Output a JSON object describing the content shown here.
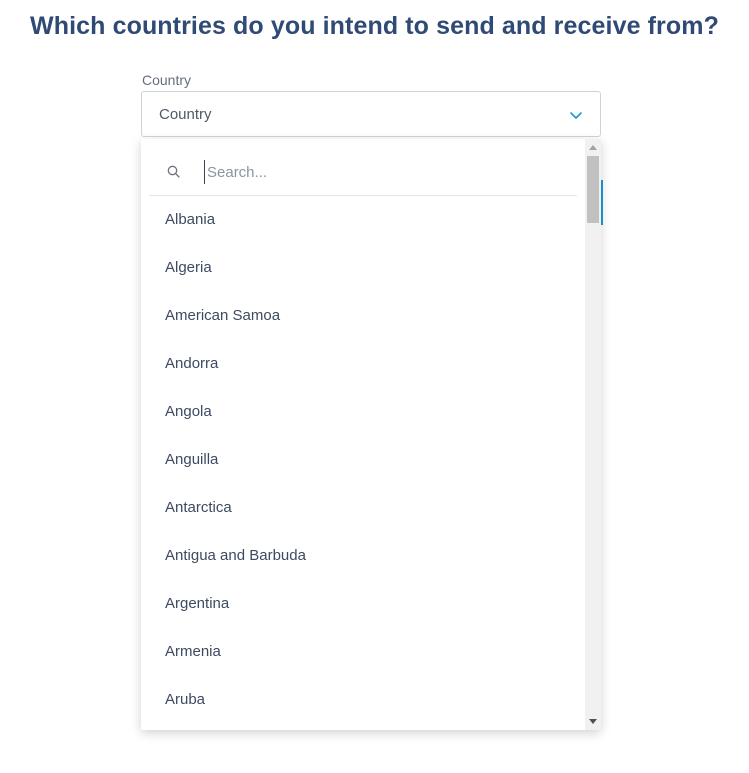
{
  "page": {
    "heading": "Which countries do you intend to send and receive from?"
  },
  "country_select": {
    "label": "Country",
    "value": "Country",
    "chevron_icon": "chevron-down-icon",
    "accent_color": "#1a9bd7"
  },
  "dropdown": {
    "search": {
      "icon": "search-icon",
      "placeholder": "Search...",
      "value": ""
    },
    "options": [
      {
        "label": "Albania"
      },
      {
        "label": "Algeria"
      },
      {
        "label": "American Samoa"
      },
      {
        "label": "Andorra"
      },
      {
        "label": "Angola"
      },
      {
        "label": "Anguilla"
      },
      {
        "label": "Antarctica"
      },
      {
        "label": "Antigua and Barbuda"
      },
      {
        "label": "Argentina"
      },
      {
        "label": "Armenia"
      },
      {
        "label": "Aruba"
      }
    ]
  },
  "colors": {
    "heading": "#2f4a75",
    "option_text": "#3c4a62"
  }
}
